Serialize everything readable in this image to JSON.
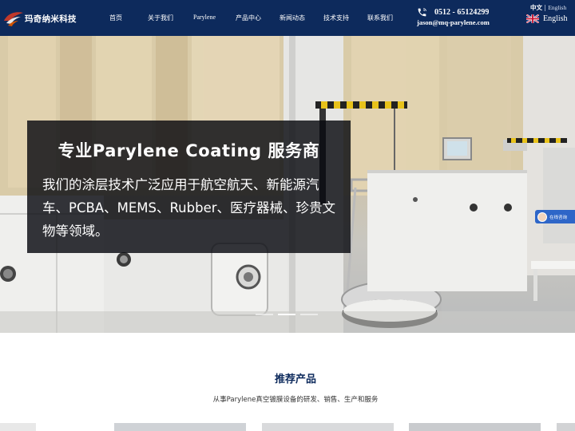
{
  "header": {
    "logo_text": "玛奇纳米科技",
    "nav": [
      {
        "label": "首页"
      },
      {
        "label": "关于我们"
      },
      {
        "label": "Parylene"
      },
      {
        "label": "产品中心"
      },
      {
        "label": "新闻动态"
      },
      {
        "label": "技术支持"
      },
      {
        "label": "联系我们"
      }
    ],
    "phone": "0512 - 65124299",
    "email": "jason@mq-parylene.com",
    "lang_current": "中文",
    "lang_sep": "|",
    "lang_alt": "English",
    "lang_button": "English"
  },
  "hero": {
    "title": "专业Parylene Coating 服务商",
    "description": "我们的涂层技术广泛应用于航空航天、新能源汽车、PCBA、MEMS、Rubber、医疗器械、珍贵文物等领域。",
    "slides": 3,
    "active_slide": 2,
    "chat_label": "在线咨询"
  },
  "products": {
    "title": "推荐产品",
    "subtitle": "从事Parylene真空镀膜设备的研发、销售、生产和服务"
  },
  "colors": {
    "header_bg": "#0d2a5c",
    "accent": "#0d2a5c",
    "chat_button": "#2e66c8"
  },
  "icons": [
    "logo-mark-icon",
    "phone-icon",
    "uk-flag-icon",
    "chat-avatar-icon"
  ]
}
